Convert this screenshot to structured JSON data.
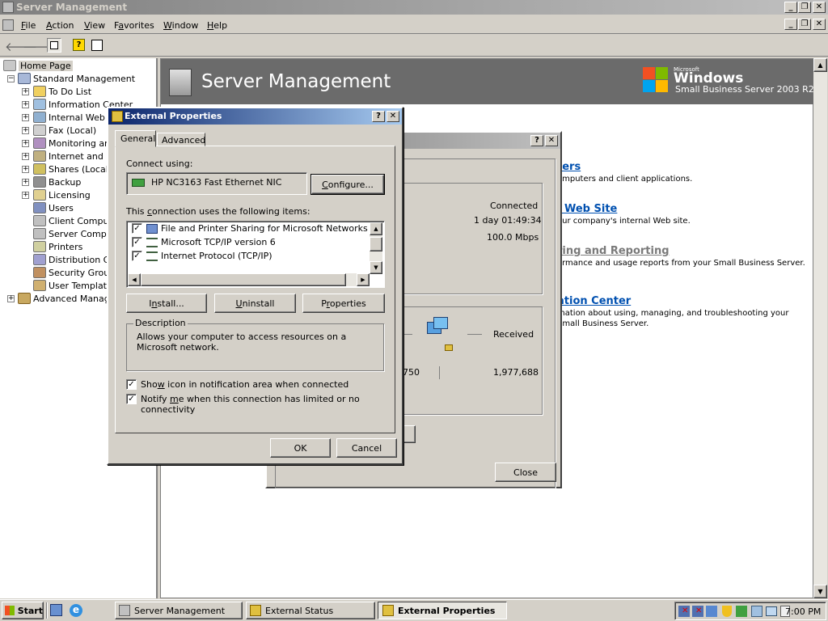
{
  "app": {
    "title": "Server Management",
    "menu": [
      "File",
      "Action",
      "View",
      "Favorites",
      "Window",
      "Help"
    ],
    "colors": {
      "title_active": "#0a246a",
      "title_inactive": "#808080",
      "face": "#d4d0c8"
    }
  },
  "tree": {
    "root": "Home Page",
    "standard": "Standard Management",
    "items": [
      "To Do List",
      "Information Center",
      "Internal Web S",
      "Fax (Local)",
      "Monitoring and",
      "Internet and E",
      "Shares (Local)",
      "Backup",
      "Licensing",
      "Users",
      "Client Compute",
      "Server Compu",
      "Printers",
      "Distribution Gr",
      "Security Group",
      "User Template"
    ],
    "advanced": "Advanced Manage"
  },
  "banner": {
    "title": "Server Management",
    "brand_small": "Microsoft",
    "brand_big": "Windows",
    "brand_sub": "Small Business Server 2003 R2"
  },
  "links": [
    {
      "title": "ters",
      "desc": "omputers and client applications."
    },
    {
      "title": "l Web Site",
      "desc": "our company's internal Web site."
    },
    {
      "title": "ring and Reporting",
      "desc": "ormance and usage reports from your Small Business Server."
    },
    {
      "title": "ation Center",
      "desc": "mation about using, managing, and troubleshooting your\nSmall Business Server."
    }
  ],
  "status_dialog": {
    "status": "Connected",
    "duration": "1 day 01:49:34",
    "speed": "100.0 Mbps",
    "received_label": "Received",
    "sent_partial": "750",
    "received_value": "1,977,688",
    "close": "Close"
  },
  "props_dialog": {
    "title": "External Properties",
    "tabs": [
      "General",
      "Advanced"
    ],
    "connect_using_label": "Connect using:",
    "adapter": "HP NC3163 Fast Ethernet NIC",
    "configure": "Configure...",
    "items_label": "This connection uses the following items:",
    "items": [
      "File and Printer Sharing for Microsoft Networks",
      "Microsoft TCP/IP version 6",
      "Internet Protocol (TCP/IP)"
    ],
    "install": "Install...",
    "uninstall": "Uninstall",
    "properties": "Properties",
    "description_label": "Description",
    "description": "Allows your computer to access resources on a Microsoft network.",
    "show_icon": "Show icon in notification area when connected",
    "notify": "Notify me when this connection has limited or no connectivity",
    "ok": "OK",
    "cancel": "Cancel"
  },
  "taskbar": {
    "start": "Start",
    "tasks": [
      "Server Management",
      "External Status",
      "External Properties"
    ],
    "clock": "7:00 PM"
  }
}
